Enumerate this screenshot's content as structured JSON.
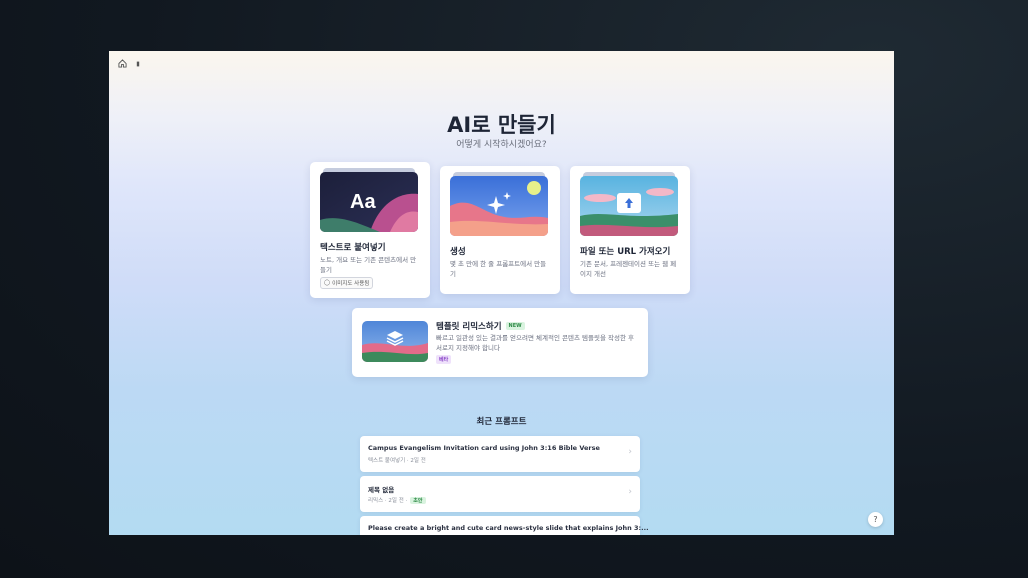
{
  "nav": {
    "home_label": ""
  },
  "header": {
    "title": "AI로 만들기",
    "subtitle": "어떻게 시작하시겠어요?"
  },
  "cards": [
    {
      "title": "텍스트로 붙여넣기",
      "desc": "노트, 개요 또는 기존 콘텐츠에서 만들기",
      "chip": "이미지도 사용됨"
    },
    {
      "title": "생성",
      "desc": "몇 초 만에 한 줄 프롬프트에서 만들기"
    },
    {
      "title": "파일 또는 URL 가져오기",
      "desc": "기존 문서, 프레젠테이션 또는 웹 페이지 개선"
    }
  ],
  "template_card": {
    "title": "템플릿 리믹스하기",
    "badge": "NEW",
    "desc": "빠르고 일관성 있는 결과를 얻으려면 체계적인 콘텐츠 템플릿을 작성한 후 서로지 지정해야 합니다",
    "tag": "베타"
  },
  "recent": {
    "title": "최근 프롬프트",
    "items": [
      {
        "title": "Campus Evangelism Invitation card using John 3:16 Bible Verse",
        "meta": "텍스트 붙여넣기 · 2일 전",
        "badge": ""
      },
      {
        "title": "제목 없음",
        "meta": "리믹스 · 2일 전 ·",
        "badge": "초안"
      },
      {
        "title": "Please create a bright and cute card news-style slide that explains John 3:...",
        "meta": "",
        "badge": ""
      }
    ]
  },
  "help": {
    "label": "?"
  },
  "thumbs": {
    "paste_text": "Aa"
  }
}
